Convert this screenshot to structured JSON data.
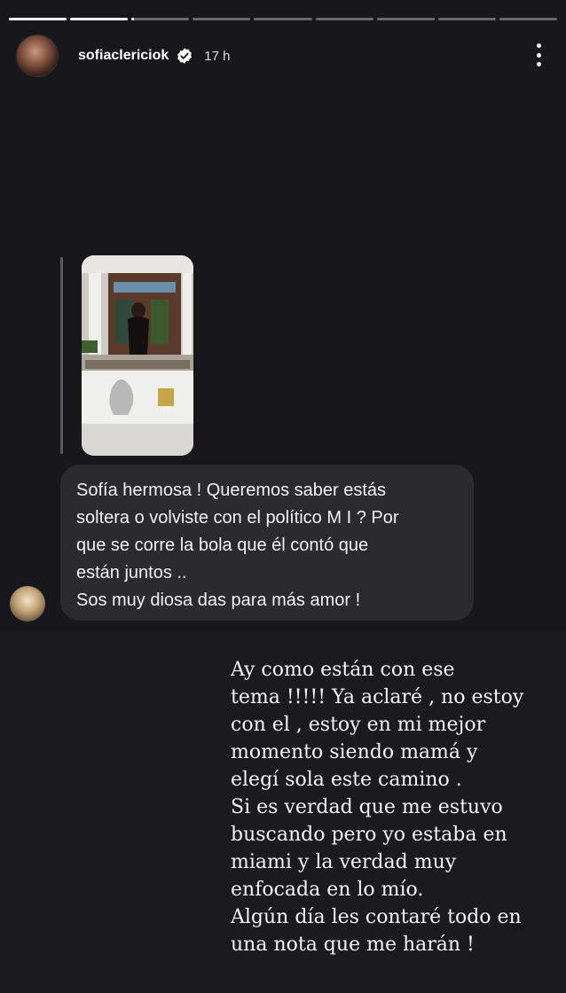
{
  "story": {
    "progress": [
      1,
      1,
      0.05,
      0,
      0,
      0,
      0,
      0,
      0
    ]
  },
  "header": {
    "username": "sofiaclericiok",
    "time": "17 h",
    "verified_icon": "verified-badge-icon",
    "menu_icon": "more-vertical-icon"
  },
  "question": {
    "lines": [
      "Sofía hermosa ! Queremos saber estás",
      "soltera o volviste con el político M I ? Por",
      "que se corre la bola que él contó que",
      "están juntos ..",
      "Sos muy diosa das para más amor !"
    ]
  },
  "answer": {
    "text": "Ay como están con ese\ntema !!!!! Ya aclaré , no estoy\ncon el , estoy en mi mejor\nmomento siendo mamá y\nelegí sola este camino .\nSi es verdad que me estuvo\nbuscando pero yo estaba en\nmiami y la verdad muy\nenfocada en lo mío.\nAlgún día les contaré todo en\nuna nota que me harán !"
  }
}
